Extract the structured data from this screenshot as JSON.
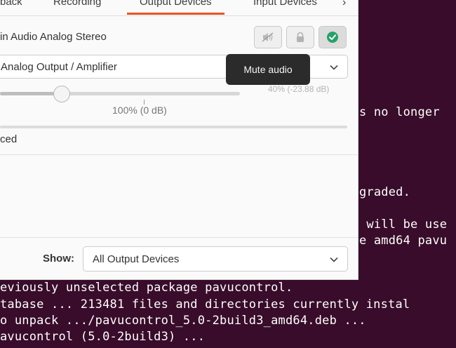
{
  "tabs": {
    "items": [
      {
        "label": "back"
      },
      {
        "label": "Recording"
      },
      {
        "label": "Output Devices"
      },
      {
        "label": "Input Devices"
      }
    ],
    "scroll_icon": "chevron-right-icon"
  },
  "device": {
    "name": "in Audio Analog Stereo",
    "port_value": "Analog Output / Amplifier",
    "mute_icon": "speaker-muted-icon",
    "lock_icon": "lock-icon",
    "default_icon": "check-circle-icon",
    "volume_percent": 40,
    "volume_readout": "40% (-23.88 dB)",
    "slider_mark_label": "100% (0 dB)",
    "advanced_label": "ced"
  },
  "tooltip": {
    "text": "Mute audio"
  },
  "footer": {
    "show_label": "Show:",
    "show_value": "All Output Devices"
  },
  "terminal": {
    "lines": [
      "s no longer",
      "graded.",
      " will be use",
      "e amd64 pavu",
      "eviously unselected package pavucontrol.",
      "tabase ... 213481 files and directories currently instal",
      "o unpack .../pavucontrol_5.0-2build3_amd64.deb ...",
      "avucontrol (5.0-2build3) ..."
    ]
  },
  "colors": {
    "terminal_bg": "#380c2a",
    "accent": "#e95420",
    "success": "#26a269"
  }
}
